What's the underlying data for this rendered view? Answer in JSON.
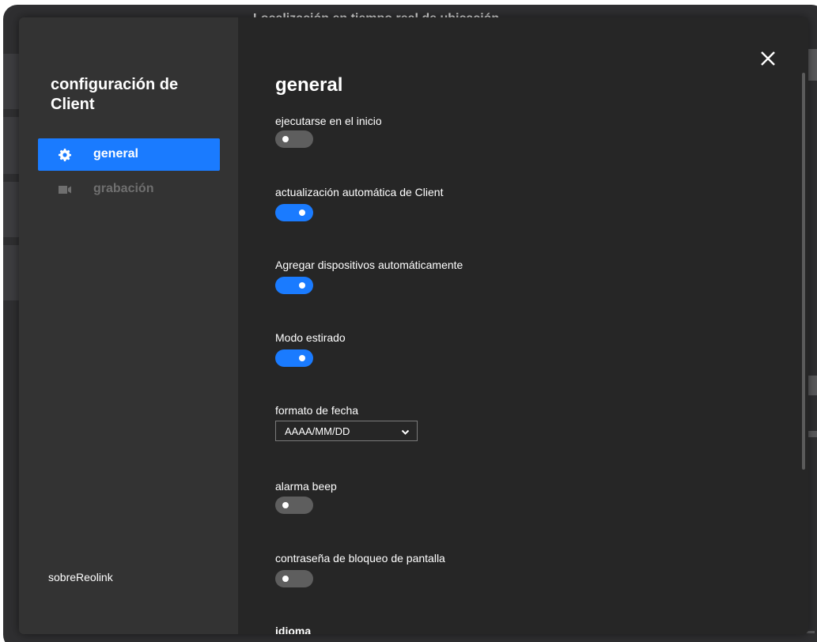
{
  "background_window": {
    "title": "Localización en tiempo real de ubicación"
  },
  "dialog": {
    "sidebar": {
      "title": "configuración de Client",
      "items": [
        {
          "label": "general",
          "icon": "gear-icon",
          "active": true
        },
        {
          "label": "grabación",
          "icon": "video-camera-icon",
          "active": false
        }
      ],
      "about_label": "sobreReolink"
    },
    "content": {
      "section_title": "general",
      "settings": [
        {
          "label": "ejecutarse en el inicio",
          "type": "toggle",
          "enabled": false
        },
        {
          "label": "actualización automática de Client",
          "type": "toggle",
          "enabled": true
        },
        {
          "label": "Agregar dispositivos automáticamente",
          "type": "toggle",
          "enabled": true
        },
        {
          "label": "Modo estirado",
          "type": "toggle",
          "enabled": true
        },
        {
          "label": "formato de fecha",
          "type": "select",
          "value": "AAAA/MM/DD"
        },
        {
          "label": "alarma beep",
          "type": "toggle",
          "enabled": false
        },
        {
          "label": "contraseña de bloqueo de pantalla",
          "type": "toggle",
          "enabled": false
        },
        {
          "label": "idioma",
          "type": "select"
        }
      ]
    },
    "close_icon": "close-icon"
  },
  "colors": {
    "accent": "#1a7bff",
    "dialog_bg": "#262626",
    "sidebar_bg": "#333333",
    "toggle_off": "#5e5e5e"
  }
}
